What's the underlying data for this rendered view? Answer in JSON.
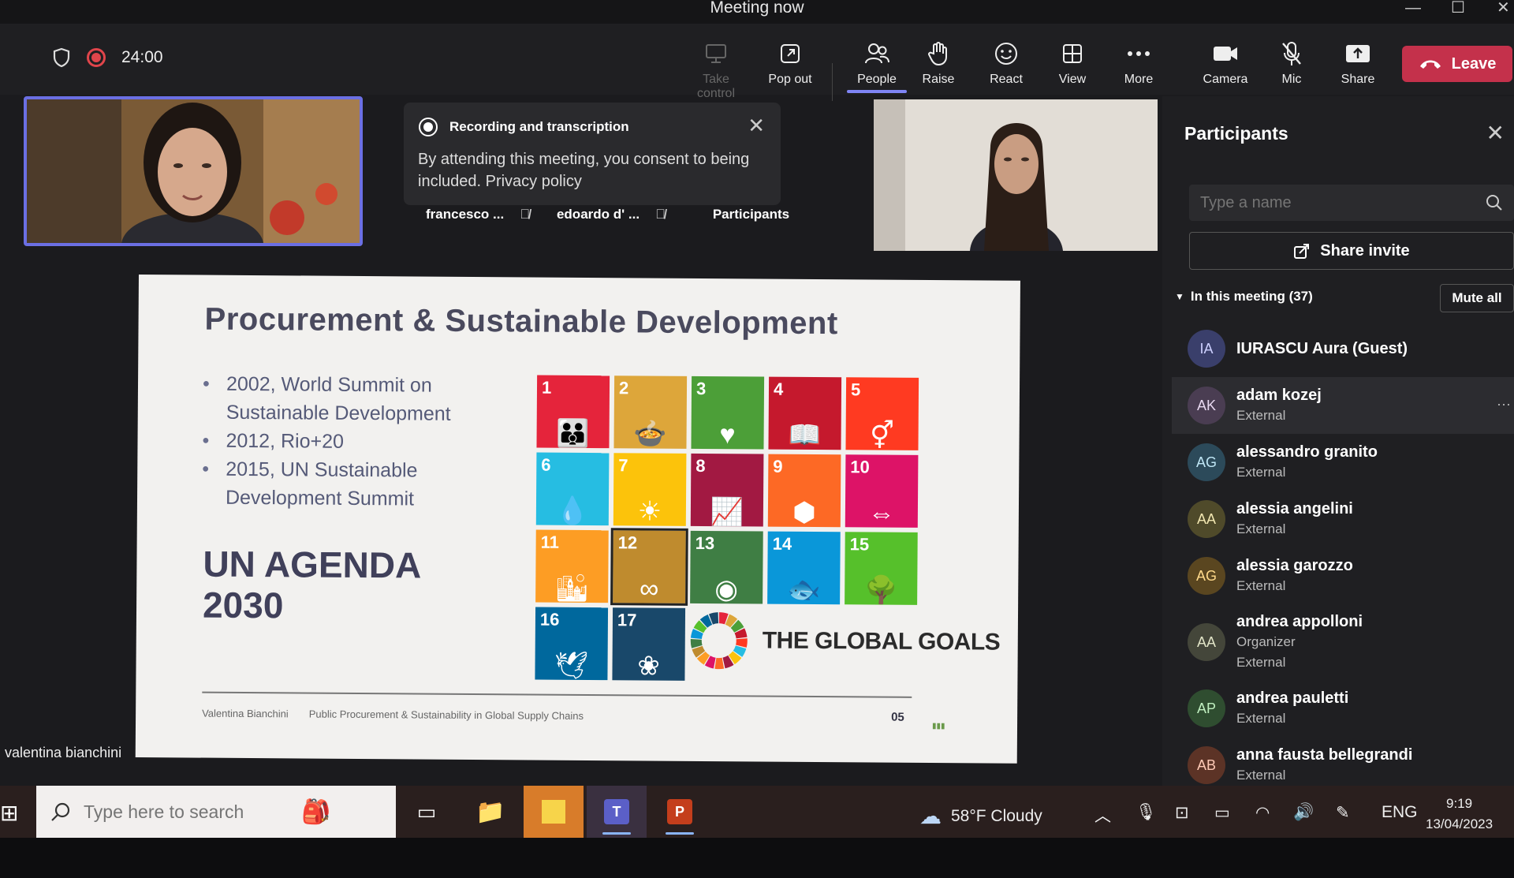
{
  "window": {
    "title": "Meeting now"
  },
  "toolbar": {
    "timer": "24:00",
    "buttons": [
      {
        "label": "Take control",
        "icon": "take-control-icon",
        "enabled": false
      },
      {
        "label": "Pop out",
        "icon": "pop-out-icon"
      },
      {
        "label": "People",
        "icon": "people-icon",
        "active": true
      },
      {
        "label": "Raise",
        "icon": "raise-hand-icon"
      },
      {
        "label": "React",
        "icon": "react-icon"
      },
      {
        "label": "View",
        "icon": "view-icon"
      },
      {
        "label": "More",
        "icon": "more-icon"
      },
      {
        "label": "Camera",
        "icon": "camera-icon"
      },
      {
        "label": "Mic",
        "icon": "mic-off-icon"
      },
      {
        "label": "Share",
        "icon": "share-icon"
      }
    ],
    "leave_label": "Leave"
  },
  "notice": {
    "title": "Recording and transcription",
    "body": "By attending this meeting, you consent to being included. Privacy policy"
  },
  "stage": {
    "participants": [
      {
        "name": "francesco ..."
      },
      {
        "name": "edoardo d' ..."
      }
    ],
    "participants_label": "Participants",
    "presenter": "valentina bianchini"
  },
  "slide": {
    "title": "Procurement & Sustainable Development",
    "bullets": [
      "2002, World Summit on Sustainable Development",
      "2012, Rio+20",
      "2015, UN Sustainable Development Summit"
    ],
    "agenda": "UN AGENDA 2030",
    "sdgs": [
      {
        "n": "1",
        "color": "#e5243b"
      },
      {
        "n": "2",
        "color": "#dda63a"
      },
      {
        "n": "3",
        "color": "#4c9f38"
      },
      {
        "n": "4",
        "color": "#c5192d"
      },
      {
        "n": "5",
        "color": "#ff3a21"
      },
      {
        "n": "6",
        "color": "#26bde2"
      },
      {
        "n": "7",
        "color": "#fcc30b"
      },
      {
        "n": "8",
        "color": "#a21942"
      },
      {
        "n": "9",
        "color": "#fd6925"
      },
      {
        "n": "10",
        "color": "#dd1367"
      },
      {
        "n": "11",
        "color": "#fd9d24"
      },
      {
        "n": "12",
        "color": "#bf8b2e"
      },
      {
        "n": "13",
        "color": "#3f7e44"
      },
      {
        "n": "14",
        "color": "#0a97d9"
      },
      {
        "n": "15",
        "color": "#56c02b"
      },
      {
        "n": "16",
        "color": "#00689d"
      },
      {
        "n": "17",
        "color": "#19486a"
      }
    ],
    "global_goals": "THE GLOBAL GOALS",
    "footer_author": "Valentina Bianchini",
    "footer_course": "Public Procurement & Sustainability in Global Supply Chains",
    "page": "05"
  },
  "panel": {
    "title": "Participants",
    "search_placeholder": "Type a name",
    "share_invite": "Share invite",
    "group_label": "In this meeting (37)",
    "mute_all": "Mute all",
    "people": [
      {
        "initials": "IA",
        "name": "IURASCU Aura (Guest)",
        "roles": [],
        "avatar_bg": "#3a3f6b",
        "avatar_fg": "#cdd0ff"
      },
      {
        "initials": "AK",
        "name": "adam kozej",
        "roles": [
          "External"
        ],
        "avatar_bg": "#4a3d52",
        "avatar_fg": "#e8d8f0"
      },
      {
        "initials": "AG",
        "name": "alessandro granito",
        "roles": [
          "External"
        ],
        "avatar_bg": "#2c4a5a",
        "avatar_fg": "#bfe6f5"
      },
      {
        "initials": "AA",
        "name": "alessia angelini",
        "roles": [
          "External"
        ],
        "avatar_bg": "#4f4a2a",
        "avatar_fg": "#f1e6b0"
      },
      {
        "initials": "AG",
        "name": "alessia garozzo",
        "roles": [
          "External"
        ],
        "avatar_bg": "#5a4620",
        "avatar_fg": "#ffd98a"
      },
      {
        "initials": "AA",
        "name": "andrea appolloni",
        "roles": [
          "Organizer",
          "External"
        ],
        "avatar_bg": "#44463a",
        "avatar_fg": "#e1e4c7"
      },
      {
        "initials": "AP",
        "name": "andrea pauletti",
        "roles": [
          "External"
        ],
        "avatar_bg": "#2f4d30",
        "avatar_fg": "#bfeebf"
      },
      {
        "initials": "AB",
        "name": "anna fausta bellegrandi",
        "roles": [
          "External"
        ],
        "avatar_bg": "#5c3326",
        "avatar_fg": "#ffc9b5"
      }
    ]
  },
  "taskbar": {
    "search_placeholder": "Type here to search",
    "weather": "58°F  Cloudy",
    "language": "ENG",
    "time": "9:19",
    "date": "13/04/2023"
  }
}
